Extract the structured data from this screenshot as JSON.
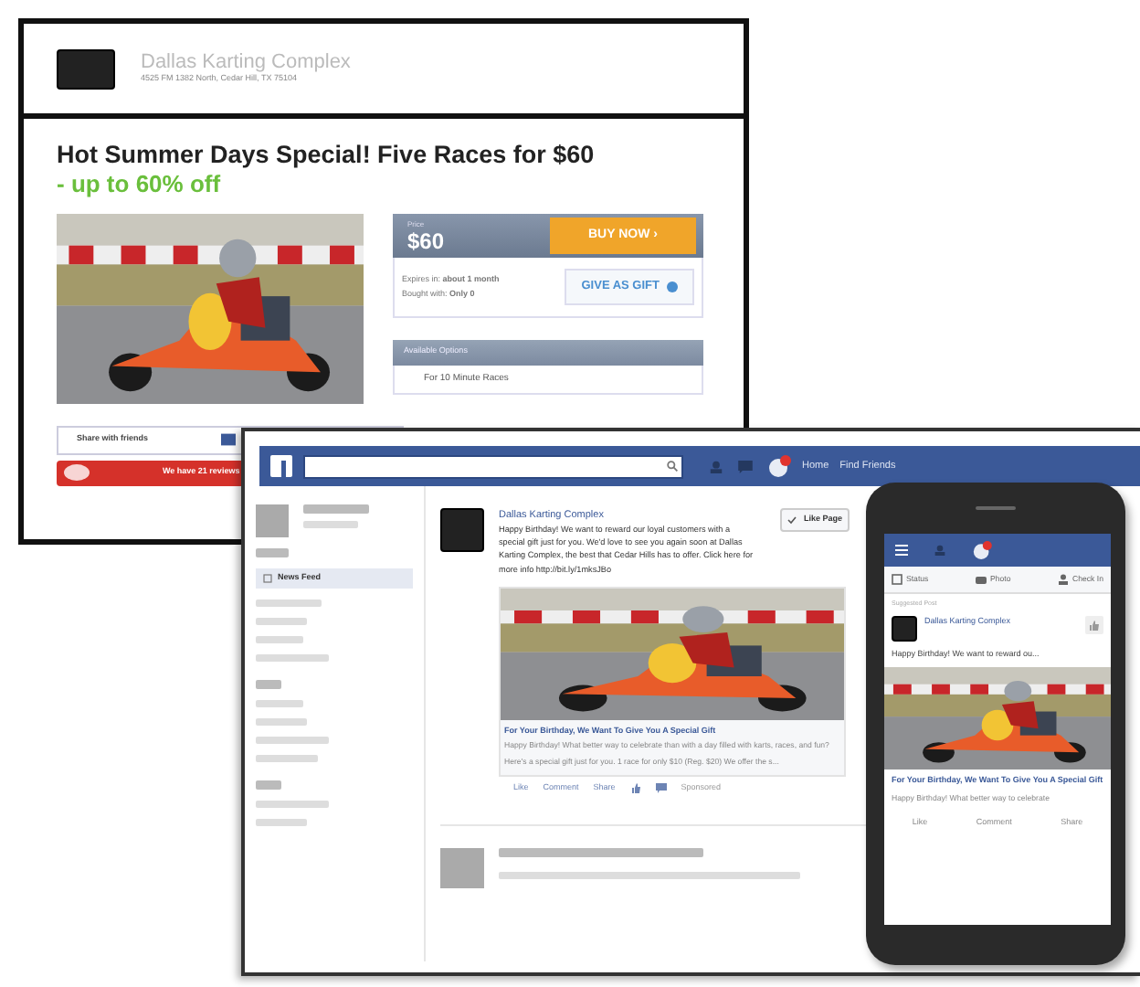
{
  "deal_page": {
    "business_name": "Dallas Karting Complex",
    "address": "4525 FM 1382 North, Cedar Hill, TX 75104",
    "headline": "Hot Summer Days Special! Five Races for $60",
    "discount": "- up to 60% off",
    "price_label": "Price",
    "price": "$60",
    "buy_button": "BUY NOW ›",
    "expires_label": "Expires in:",
    "expires_value": "about 1 month",
    "bought_label": "Bought with:",
    "bought_value": "Only 0",
    "gift_button": "GIVE AS GIFT",
    "options_title": "Available Options",
    "options": [
      "For 10 Minute Races"
    ],
    "share_label": "Share with friends",
    "reviews_text": "We have 21 reviews"
  },
  "facebook": {
    "nav": [
      "Home",
      "Find Friends"
    ],
    "sidebar_item": "News Feed",
    "post": {
      "page_name": "Dallas Karting Complex",
      "text": "Happy Birthday! We want to reward our loyal customers with a special gift just for you. We'd love to see you again soon at Dallas Karting Complex, the best that Cedar Hills has to offer. Click here for more info http://bit.ly/1mksJBo",
      "like_page": "Like Page",
      "link_title": "For Your Birthday, We Want To Give You A Special Gift",
      "link_desc": "Happy Birthday! What better way to celebrate than with a day filled with karts, races, and fun? Here's a special gift just for you. 1 race for only $10 (Reg. $20) We offer the s...",
      "actions": [
        "Like",
        "Comment",
        "Share"
      ],
      "sponsored": "Sponsored"
    }
  },
  "phone": {
    "actions": [
      "Status",
      "Photo",
      "Check In"
    ],
    "suggested": "Suggested Post",
    "page_name": "Dallas Karting Complex",
    "text": "Happy Birthday! We want to reward ou...",
    "link_title": "For Your Birthday, We Want To Give You A Special Gift",
    "link_desc": "Happy Birthday! What better way to celebrate",
    "buttons": [
      "Like",
      "Comment",
      "Share"
    ]
  }
}
